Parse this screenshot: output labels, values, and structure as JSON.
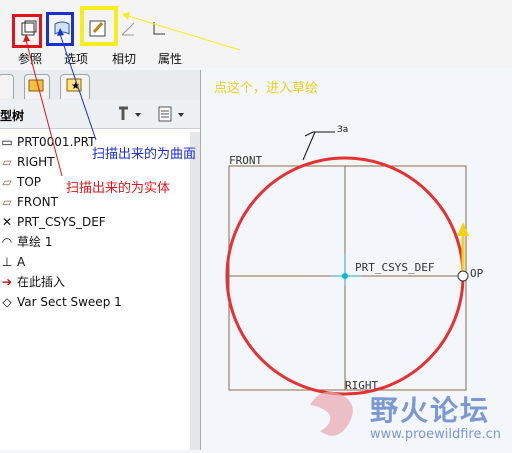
{
  "toolbar": {
    "buttons": [
      {
        "name": "solid-button",
        "icon": "solid-icon"
      },
      {
        "name": "surface-button",
        "icon": "surface-icon"
      },
      {
        "name": "sketch-button",
        "icon": "sketch-icon"
      },
      {
        "name": "tangent-button",
        "icon": "tangent-icon"
      },
      {
        "name": "properties-button",
        "icon": "properties-icon"
      }
    ],
    "labels": {
      "references": "参照",
      "options": "选项",
      "tangent": "相切",
      "properties": "属性"
    }
  },
  "tree": {
    "title": "型树",
    "items": [
      {
        "label": "PRT0001.PRT",
        "icon": "part-icon"
      },
      {
        "label": "RIGHT",
        "icon": "datum-plane-icon"
      },
      {
        "label": "TOP",
        "icon": "datum-plane-icon"
      },
      {
        "label": "FRONT",
        "icon": "datum-plane-icon"
      },
      {
        "label": "PRT_CSYS_DEF",
        "icon": "csys-icon"
      },
      {
        "label": "草绘 1",
        "icon": "sketch-feature-icon"
      },
      {
        "label": "A",
        "icon": "axis-icon"
      },
      {
        "label": "在此插入",
        "icon": "insert-arrow-icon"
      },
      {
        "label": "Var Sect Sweep 1",
        "icon": "sweep-icon"
      }
    ]
  },
  "annotations": {
    "blue": "扫描出来的为曲面",
    "red": "扫描出来的为实体",
    "yellow": "点这个，进入草绘"
  },
  "canvas": {
    "front": "FRONT",
    "csys": "PRT_CSYS_DEF",
    "top": "OP",
    "right": "RIGHT",
    "callout": "За"
  },
  "watermark": {
    "title": "野火论坛",
    "url": "www.proewildfire.cn"
  },
  "colors": {
    "red": "#e53131",
    "blue": "#1a2fd0",
    "yellow": "#f6ee1c",
    "frame": "#8b6a4a"
  }
}
